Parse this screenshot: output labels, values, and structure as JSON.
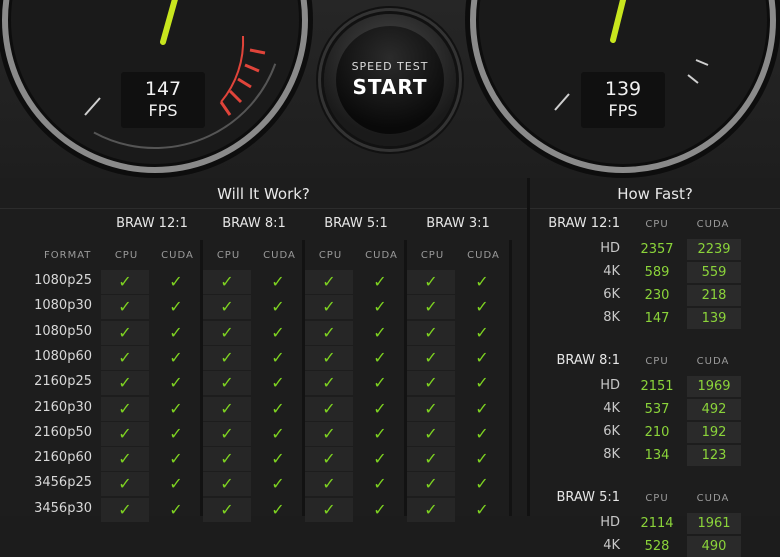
{
  "gauges": [
    {
      "name": "write",
      "value": "147",
      "unit": "FPS"
    },
    {
      "name": "read",
      "value": "139",
      "unit": "FPS"
    }
  ],
  "speed_test": {
    "label": "SPEED TEST",
    "action": "START"
  },
  "will_it_work": {
    "title": "Will It Work?",
    "format_label": "FORMAT",
    "codecs": [
      "BRAW 12:1",
      "BRAW 8:1",
      "BRAW 5:1",
      "BRAW 3:1"
    ],
    "sub_cols": [
      "CPU",
      "CUDA"
    ],
    "formats": [
      "1080p25",
      "1080p30",
      "1080p50",
      "1080p60",
      "2160p25",
      "2160p30",
      "2160p50",
      "2160p60",
      "3456p25",
      "3456p30"
    ],
    "check": "✓"
  },
  "how_fast": {
    "title": "How Fast?",
    "sub_cols": [
      "CPU",
      "CUDA"
    ],
    "groups": [
      {
        "codec": "BRAW 12:1",
        "rows": [
          {
            "res": "HD",
            "cpu": "2357",
            "cuda": "2239"
          },
          {
            "res": "4K",
            "cpu": "589",
            "cuda": "559"
          },
          {
            "res": "6K",
            "cpu": "230",
            "cuda": "218"
          },
          {
            "res": "8K",
            "cpu": "147",
            "cuda": "139"
          }
        ]
      },
      {
        "codec": "BRAW 8:1",
        "rows": [
          {
            "res": "HD",
            "cpu": "2151",
            "cuda": "1969"
          },
          {
            "res": "4K",
            "cpu": "537",
            "cuda": "492"
          },
          {
            "res": "6K",
            "cpu": "210",
            "cuda": "192"
          },
          {
            "res": "8K",
            "cpu": "134",
            "cuda": "123"
          }
        ]
      },
      {
        "codec": "BRAW 5:1",
        "rows": [
          {
            "res": "HD",
            "cpu": "2114",
            "cuda": "1961"
          },
          {
            "res": "4K",
            "cpu": "528",
            "cuda": "490"
          }
        ]
      }
    ]
  },
  "colors": {
    "check": "#7ed321",
    "value": "#8bd43a",
    "needle": "#c8e61e",
    "redline": "#e0443a"
  }
}
